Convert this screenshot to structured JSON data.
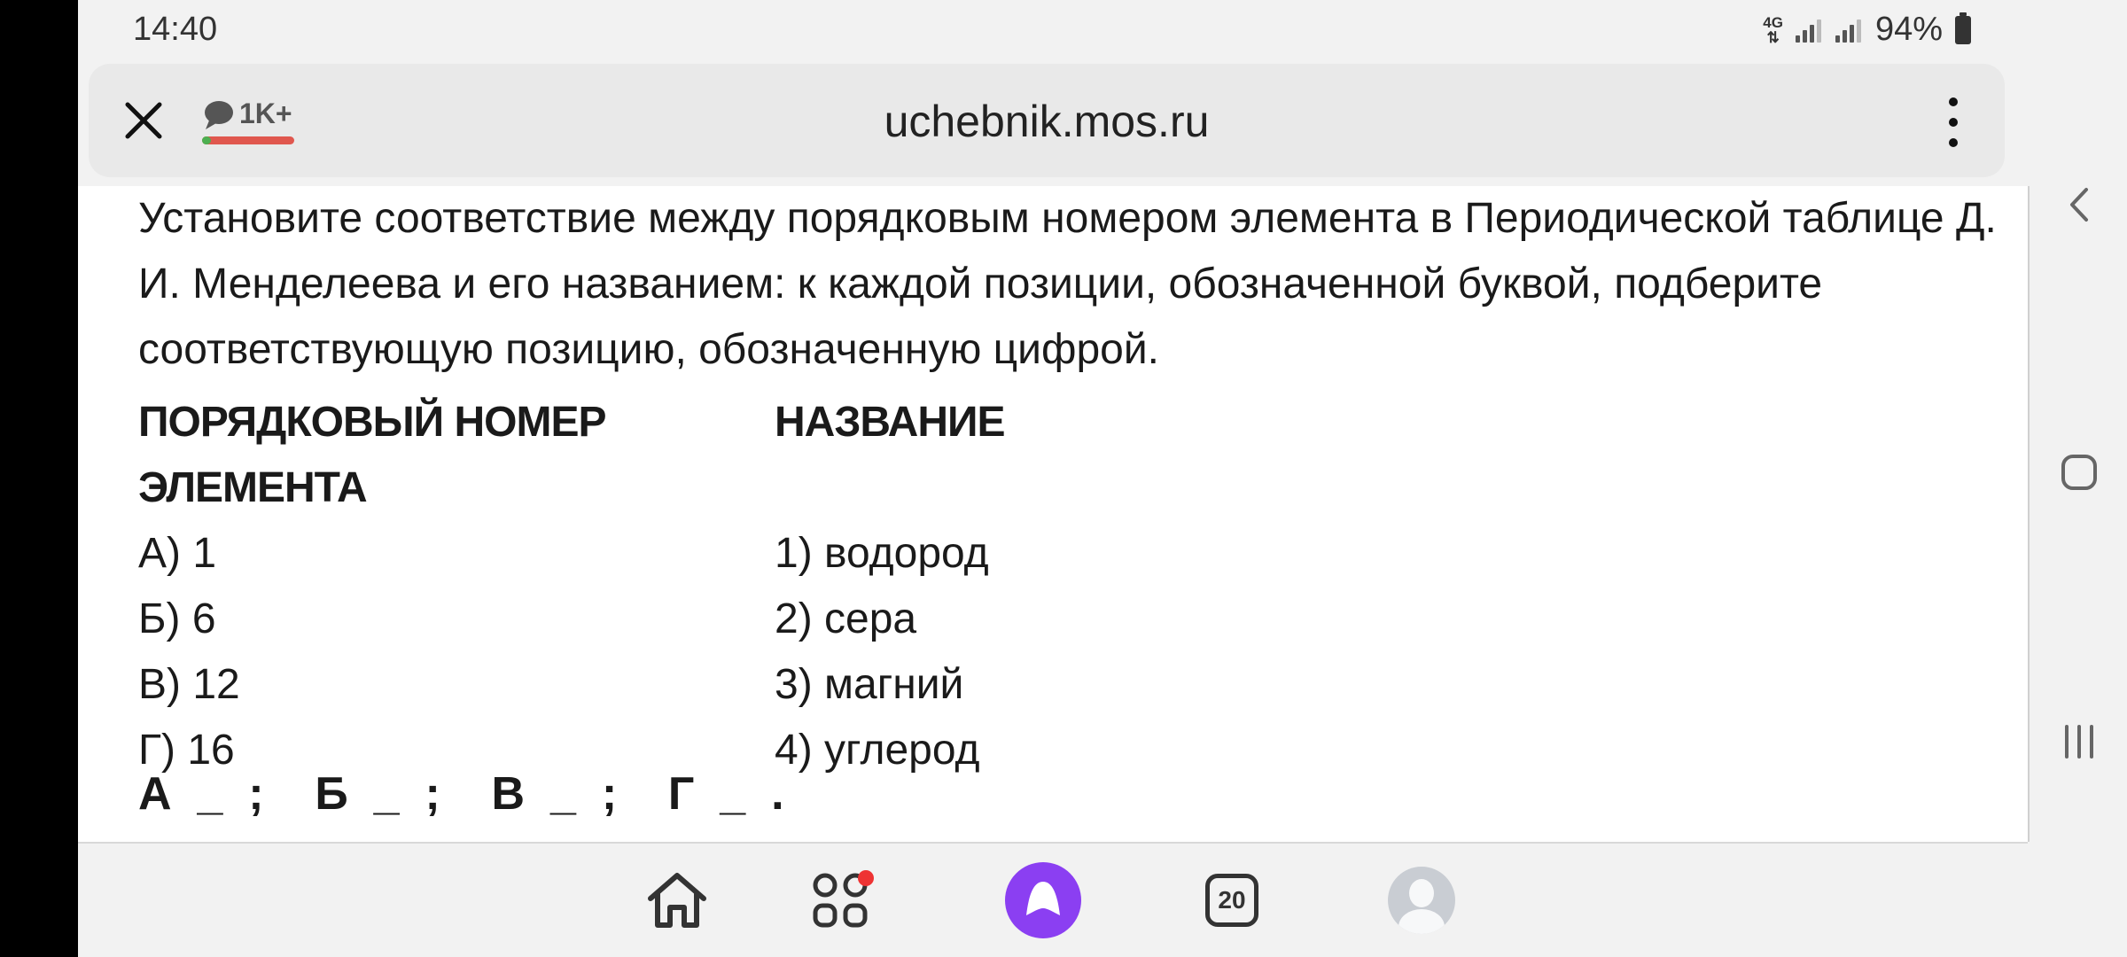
{
  "status_bar": {
    "time": "14:40",
    "network": "4G",
    "battery": "94%"
  },
  "browser": {
    "comments_count": "1K+",
    "url": "uchebnik.mos.ru"
  },
  "question": {
    "text": "Установите соответствие между порядковым номером элемента в Периодической таблице Д. И. Менделеева и его названием: к каждой позиции, обозначенной буквой, подберите соответствующую позицию, обозначенную цифрой.",
    "left_header_line1": "ПОРЯДКОВЫЙ НОМЕР",
    "left_header_line2": "ЭЛЕМЕНТА",
    "right_header": "НАЗВАНИЕ",
    "left_items": [
      "А) 1",
      "Б) 6",
      "В) 12",
      "Г) 16"
    ],
    "right_items": [
      "1) водород",
      "2) сера",
      "3) магний",
      "4) углерод"
    ],
    "answer_template": "А  _  ;    Б  _  ;    В  _  ;    Г  _  ."
  },
  "bottom_nav": {
    "tabs_count": "20"
  },
  "icons": {
    "close": "close-icon",
    "comments": "speech-bubble-icon",
    "menu": "kebab-menu-icon",
    "home": "home-icon",
    "services": "grid-icon",
    "alice": "alice-voice-assistant-icon",
    "tabs": "tabs-icon",
    "profile": "avatar-icon",
    "back": "back-chevron-icon",
    "system_home": "system-home-icon",
    "recents": "recents-icon"
  },
  "colors": {
    "alice_purple": "#8b3ff2",
    "comments_bar_red": "#e0574e",
    "comments_bar_green": "#4caf50",
    "notification_red": "#e33333"
  }
}
